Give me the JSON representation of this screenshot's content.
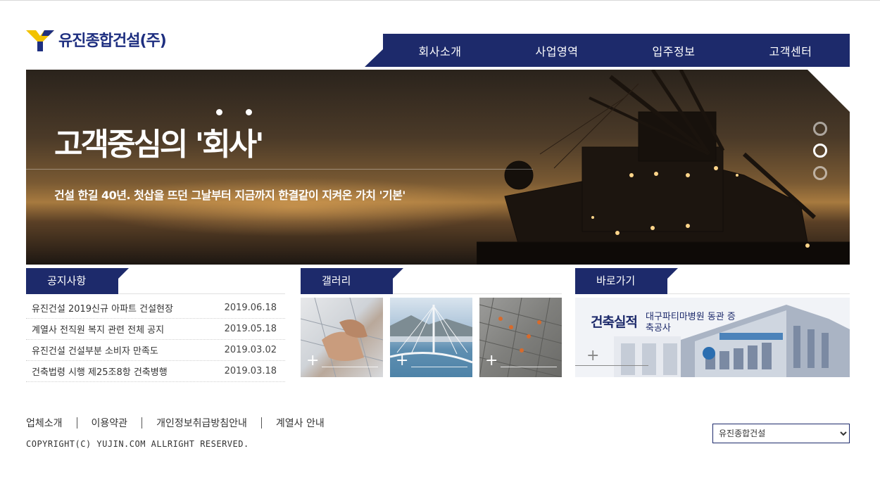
{
  "logo": {
    "text": "유진종합건설(주)"
  },
  "nav": {
    "items": [
      "회사소개",
      "사업영역",
      "입주정보",
      "고객센터"
    ]
  },
  "hero": {
    "title": "고객중심의 '회사'",
    "subtitle": "건설 한길 40년. 첫삽을 뜨던 그날부터 지금까지 한결같이 지켜온 가치 '기본'",
    "slides": 3,
    "active_slide": 2
  },
  "notice": {
    "title": "공지사항",
    "items": [
      {
        "title": "유진건설 2019신규 아파트 건설현장",
        "date": "2019.06.18"
      },
      {
        "title": "계열사 전직원 복지 관련 전체 공지",
        "date": "2019.05.18"
      },
      {
        "title": "유진건설 건설부분 소비자 만족도",
        "date": "2019.03.02"
      },
      {
        "title": "건축법령 시행 제25조8항 건축병행",
        "date": "2019.03.18"
      }
    ]
  },
  "gallery": {
    "title": "갤러리",
    "plus": "+"
  },
  "shortcut": {
    "title": "바로가기",
    "banner_title": "건축실적",
    "banner_sub": "대구파티마병원 동관 증축공사",
    "plus": "+"
  },
  "footer": {
    "links": [
      "업체소개",
      "이용약관",
      "개인정보취급방침안내",
      "계열사 안내"
    ],
    "copyright": "COPYRIGHT(C) YUJIN.COM ALLRIGHT RESERVED.",
    "family_select": {
      "selected": "유진종합건설",
      "options": [
        "유진종합건설"
      ]
    }
  },
  "colors": {
    "brand_navy": "#1d2a6b",
    "logo_yellow": "#f2c200"
  }
}
